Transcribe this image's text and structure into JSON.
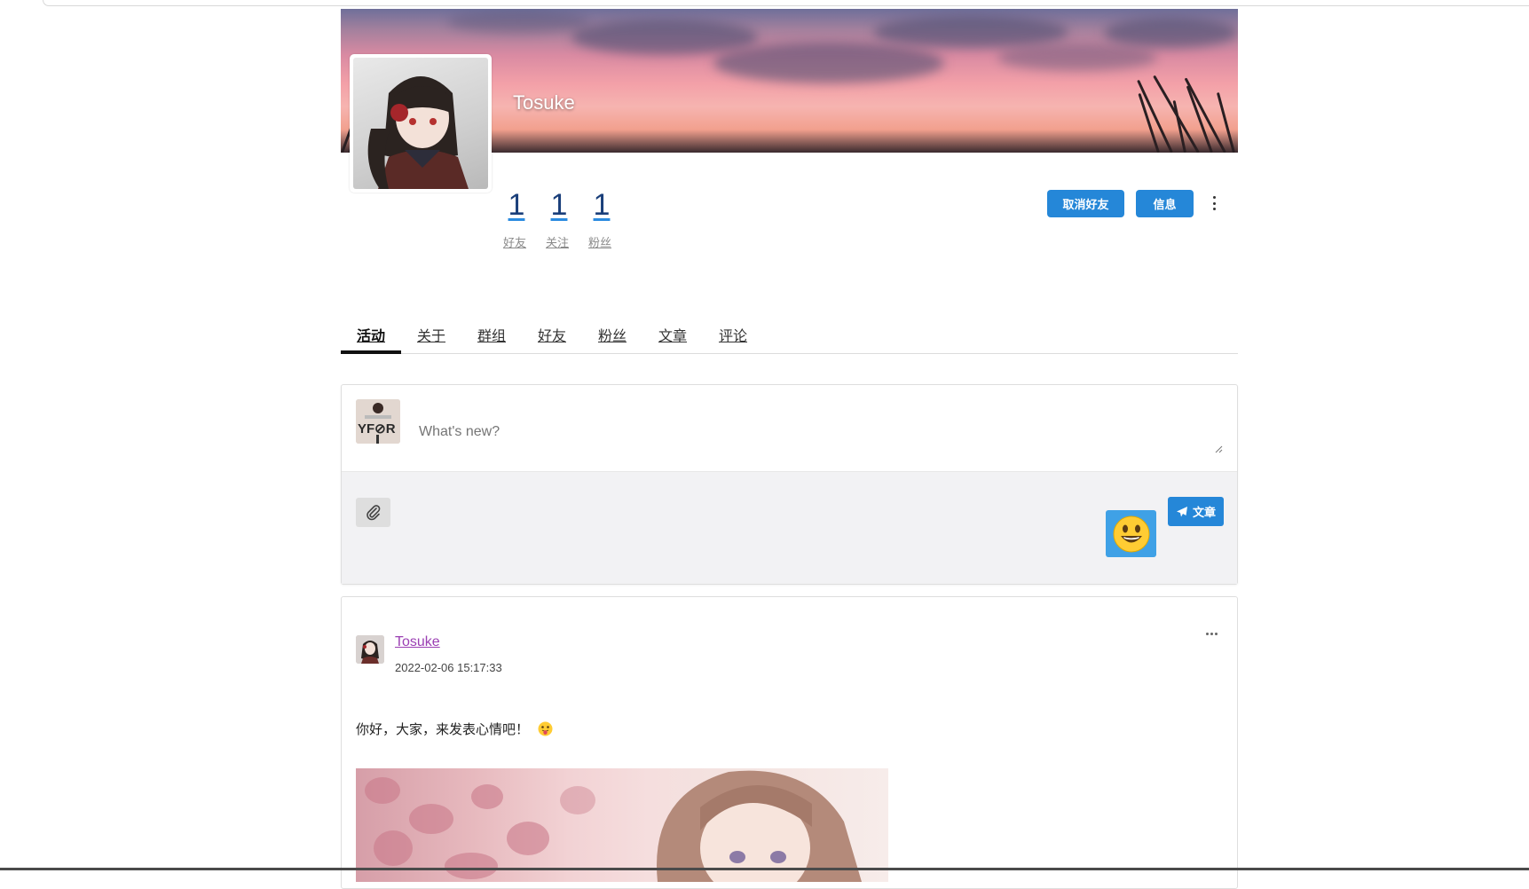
{
  "profile": {
    "username": "Tosuke",
    "stats": [
      {
        "value": "1",
        "label": "好友"
      },
      {
        "value": "1",
        "label": "关注"
      },
      {
        "value": "1",
        "label": "粉丝"
      }
    ],
    "actions": {
      "unfriend_label": "取消好友",
      "message_label": "信息"
    }
  },
  "tabs": [
    {
      "label": "活动",
      "active": true
    },
    {
      "label": "关于"
    },
    {
      "label": "群组"
    },
    {
      "label": "好友"
    },
    {
      "label": "粉丝"
    },
    {
      "label": "文章"
    },
    {
      "label": "评论"
    }
  ],
  "composer": {
    "placeholder": "What's new?",
    "avatar_text": "YF⊘R",
    "submit_label": "文章"
  },
  "activity": {
    "author": "Tosuke",
    "timestamp": "2022-02-06 15:17:33",
    "text": "你好，大家，来发表心情吧！"
  },
  "colors": {
    "accent": "#2587d8",
    "emoji_button": "#3fa1e6",
    "author_link": "#9b3fb3"
  },
  "icons": [
    "more-vertical-icon",
    "paperclip-icon",
    "smiley-emoji-icon",
    "paper-plane-icon",
    "more-horizontal-icon",
    "tongue-emoji-icon"
  ]
}
